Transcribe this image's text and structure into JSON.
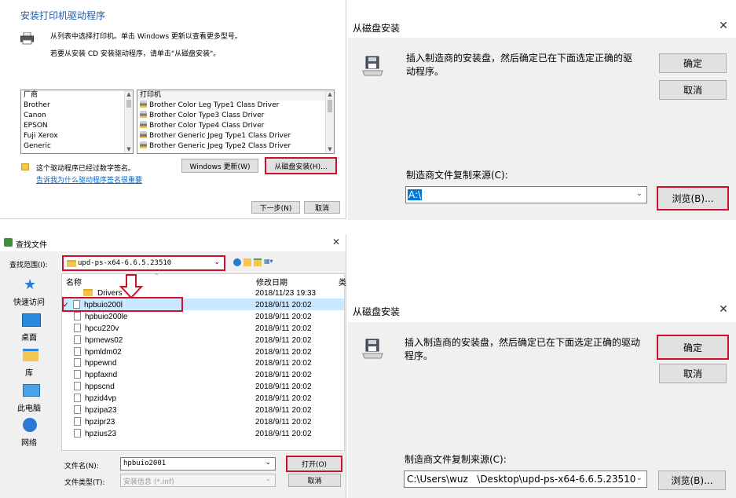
{
  "panel1": {
    "title": "安装打印机驱动程序",
    "instruction1": "从列表中选择打印机。单击 Windows 更新以查看更多型号。",
    "instruction2": "若要从安装 CD 安装驱动程序，请单击\"从磁盘安装\"。",
    "manufacturer_header": "厂商",
    "manufacturers": [
      "Brother",
      "Canon",
      "EPSON",
      "Fuji Xerox",
      "Generic"
    ],
    "printer_header": "打印机",
    "printers": [
      "Brother Color Leg Type1 Class Driver",
      "Brother Color Type3 Class Driver",
      "Brother Color Type4 Class Driver",
      "Brother Generic Jpeg Type1 Class Driver",
      "Brother Generic Jpeg Type2 Class Driver"
    ],
    "signed_text": "这个驱动程序已经过数字签名。",
    "signing_link": "告诉我为什么驱动程序签名很重要",
    "windows_update_btn": "Windows 更新(W)",
    "have_disk_btn": "从磁盘安装(H)...",
    "next_btn": "下一步(N)",
    "cancel_btn": "取消"
  },
  "panel2": {
    "title": "从磁盘安装",
    "message": "插入制造商的安装盘，然后确定已在下面选定正确的驱动程序。",
    "ok_btn": "确定",
    "cancel_btn": "取消",
    "copy_label": "制造商文件复制来源(C):",
    "path_value": "A:\\",
    "browse_btn": "浏览(B)..."
  },
  "panel3": {
    "title": "查找文件",
    "lookin_label": "查找范围(I):",
    "lookin_value": "upd-ps-x64-6.6.5.23510",
    "col_name": "名称",
    "col_date": "修改日期",
    "col_type_partial": "类",
    "sidebar": [
      "快速访问",
      "桌面",
      "库",
      "此电脑",
      "网络"
    ],
    "files": [
      {
        "name": "Drivers",
        "date": "2018/11/23 19:33",
        "folder": true
      },
      {
        "name": "hpbuio200l",
        "date": "2018/9/11 20:02",
        "selected": true
      },
      {
        "name": "hpbuio200le",
        "date": "2018/9/11 20:02"
      },
      {
        "name": "hpcu220v",
        "date": "2018/9/11 20:02"
      },
      {
        "name": "hpmews02",
        "date": "2018/9/11 20:02"
      },
      {
        "name": "hpmldm02",
        "date": "2018/9/11 20:02"
      },
      {
        "name": "hppewnd",
        "date": "2018/9/11 20:02"
      },
      {
        "name": "hppfaxnd",
        "date": "2018/9/11 20:02"
      },
      {
        "name": "hppscnd",
        "date": "2018/9/11 20:02"
      },
      {
        "name": "hpzid4vp",
        "date": "2018/9/11 20:02"
      },
      {
        "name": "hpzipa23",
        "date": "2018/9/11 20:02"
      },
      {
        "name": "hpzipr23",
        "date": "2018/9/11 20:02"
      },
      {
        "name": "hpzius23",
        "date": "2018/9/11 20:02"
      }
    ],
    "filename_label": "文件名(N):",
    "filename_value": "hpbuio2001",
    "filetype_label": "文件类型(T):",
    "filetype_value": "安装信息 (*.inf)",
    "open_btn": "打开(O)",
    "cancel_btn": "取消"
  },
  "panel4": {
    "title": "从磁盘安装",
    "message": "插入制造商的安装盘，然后确定已在下面选定正确的驱动程序。",
    "ok_btn": "确定",
    "cancel_btn": "取消",
    "copy_label": "制造商文件复制来源(C):",
    "path_value": "C:\\Users\\wuz   \\Desktop\\upd-ps-x64-6.6.5.23510",
    "browse_btn": "浏览(B)..."
  },
  "colors": {
    "highlight": "#d0102a",
    "link": "#0066cc",
    "title_blue": "#1f5aa6",
    "selection": "#cce8ff",
    "dialog_bg": "#f0f0f0"
  }
}
